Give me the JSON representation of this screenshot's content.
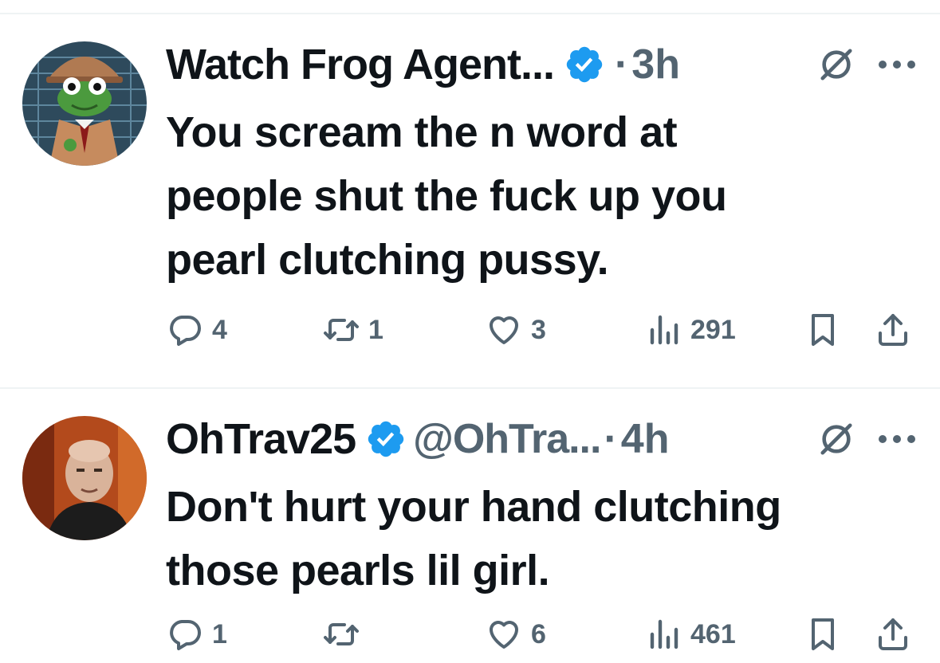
{
  "tweets": [
    {
      "display_name": "Watch Frog Agent...",
      "handle": "",
      "separator": "·",
      "time": "3h",
      "text_lines": [
        "You scream the n word at",
        "people shut the fuck up you",
        "pearl clutching pussy."
      ],
      "stats": {
        "replies": "4",
        "reposts": "1",
        "likes": "3",
        "views": "291"
      }
    },
    {
      "display_name": "OhTrav25",
      "handle": "@OhTra...",
      "separator": "·",
      "time": "4h",
      "text_lines": [
        "Don't hurt your hand clutching",
        "those pearls lil girl."
      ],
      "stats": {
        "replies": "1",
        "reposts": "",
        "likes": "6",
        "views": "461"
      }
    }
  ],
  "icons": {
    "verified": "verified-badge-icon",
    "grok": "grok-icon",
    "more": "more-icon",
    "reply": "reply-icon",
    "repost": "repost-icon",
    "like": "like-icon",
    "views": "views-icon",
    "bookmark": "bookmark-icon",
    "share": "share-icon"
  },
  "colors": {
    "verified": "#1d9bf0",
    "muted": "#536471",
    "text": "#0f1419"
  }
}
